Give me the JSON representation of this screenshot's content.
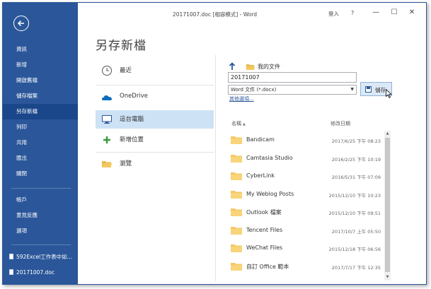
{
  "window": {
    "title": "20171007.doc [相容模式] - Word",
    "signin": "登入",
    "help": "?",
    "minimize": "—",
    "maximize": "☐",
    "close": "✕"
  },
  "rail": {
    "items": [
      {
        "label": "資訊"
      },
      {
        "label": "新增"
      },
      {
        "label": "開啟舊檔"
      },
      {
        "label": "儲存檔案"
      },
      {
        "label": "另存新檔"
      },
      {
        "label": "列印"
      },
      {
        "label": "共用"
      },
      {
        "label": "匯出"
      },
      {
        "label": "關閉"
      }
    ],
    "bottom": [
      {
        "label": "帳戶"
      },
      {
        "label": "意見反應"
      },
      {
        "label": "選項"
      }
    ],
    "recent": [
      {
        "label": "592Excel工作表中如..."
      },
      {
        "label": "20171007.doc"
      }
    ]
  },
  "page": {
    "title": "另存新檔"
  },
  "places": [
    {
      "label": "最近",
      "icon": "clock-icon"
    },
    {
      "label": "OneDrive",
      "icon": "onedrive-cloud-icon"
    },
    {
      "label": "這台電腦",
      "icon": "computer-icon"
    },
    {
      "label": "新增位置",
      "icon": "plus-icon"
    },
    {
      "label": "瀏覽",
      "icon": "folder-icon"
    }
  ],
  "save_panel": {
    "path": "我的文件",
    "filename": "20171007",
    "filetype": "Word 文件 (*.docx)",
    "more_options": "其他選項...",
    "save_label": "儲存"
  },
  "list": {
    "col_name": "名稱",
    "col_date": "修改日期",
    "rows": [
      {
        "name": "Bandicam",
        "date": "2017/6/25 下午 08:23"
      },
      {
        "name": "Camtasia Studio",
        "date": "2016/2/25 下午 10:19"
      },
      {
        "name": "CyberLink",
        "date": "2016/5/31 下午 07:09"
      },
      {
        "name": "My Weblog Posts",
        "date": "2015/12/10 下午 10:23"
      },
      {
        "name": "Outlook 檔案",
        "date": "2015/12/10 下午 09:51"
      },
      {
        "name": "Tencent Files",
        "date": "2017/10/7 上午 05:50"
      },
      {
        "name": "WeChat Files",
        "date": "2015/12/18 下午 06:56"
      },
      {
        "name": "自訂 Office 範本",
        "date": "2017/7/17 下午 12:35"
      }
    ]
  },
  "colors": {
    "accent": "#2b579a",
    "active_rail": "#19478a",
    "place_selected": "#cde2f5",
    "folder": "#f4c860"
  }
}
